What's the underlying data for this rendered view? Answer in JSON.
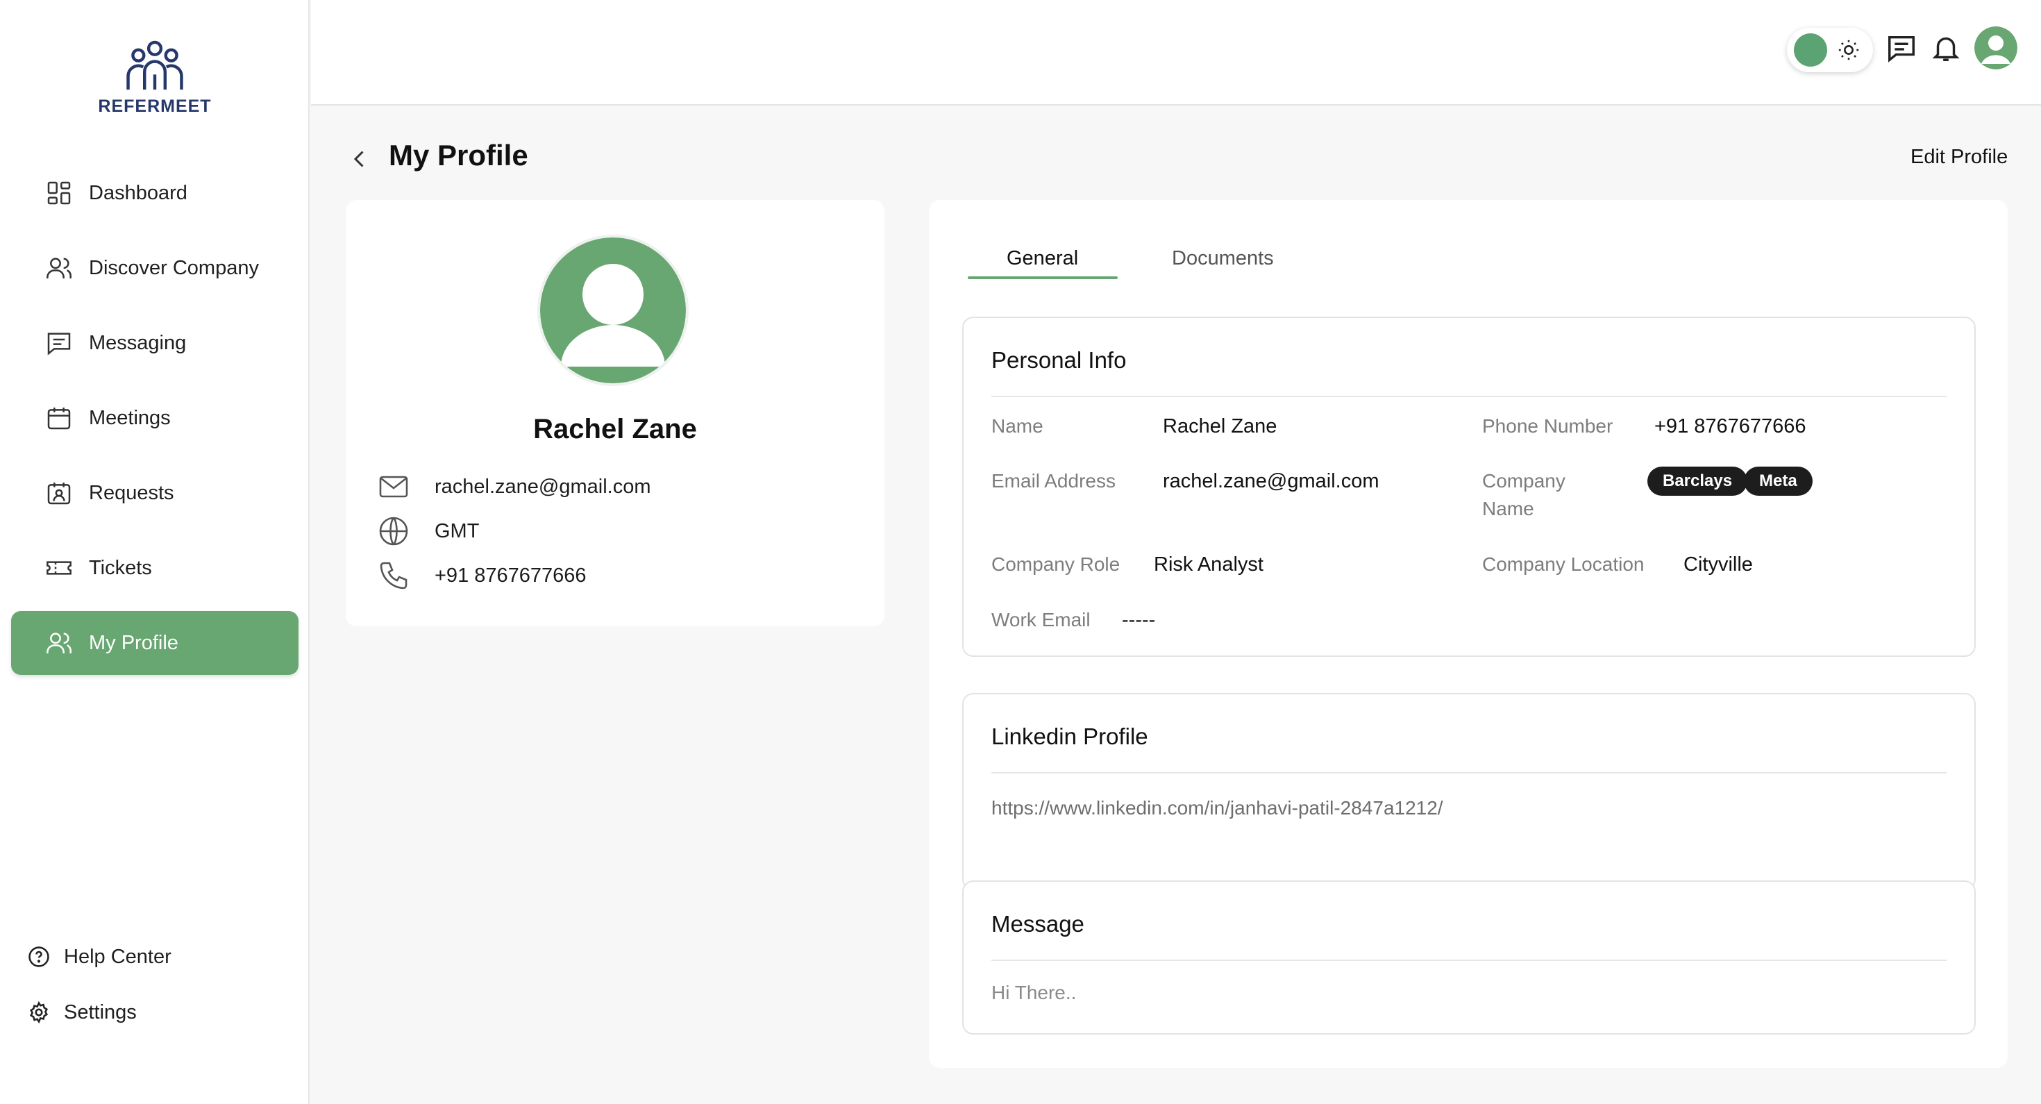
{
  "brand": {
    "name": "REFERMEET"
  },
  "sidebar": {
    "items": [
      {
        "label": "Dashboard",
        "icon": "dashboard-icon"
      },
      {
        "label": "Discover Company",
        "icon": "users-icon"
      },
      {
        "label": "Messaging",
        "icon": "message-icon"
      },
      {
        "label": "Meetings",
        "icon": "calendar-icon"
      },
      {
        "label": "Requests",
        "icon": "request-icon"
      },
      {
        "label": "Tickets",
        "icon": "ticket-icon"
      },
      {
        "label": "My Profile",
        "icon": "profile-icon",
        "active": true
      }
    ],
    "bottom": [
      {
        "label": "Help Center",
        "icon": "help-icon"
      },
      {
        "label": "Settings",
        "icon": "gear-icon"
      }
    ]
  },
  "header": {
    "title": "My Profile",
    "edit_label": "Edit Profile"
  },
  "profile": {
    "name": "Rachel Zane",
    "email": "rachel.zane@gmail.com",
    "timezone": "GMT",
    "phone": "+91 8767677666"
  },
  "tabs": [
    {
      "label": "General",
      "active": true
    },
    {
      "label": "Documents",
      "active": false
    }
  ],
  "personal_info": {
    "title": "Personal Info",
    "name_label": "Name",
    "name_value": "Rachel Zane",
    "phone_label": "Phone Number",
    "phone_value": "+91 8767677666",
    "email_label": "Email Address",
    "email_value": "rachel.zane@gmail.com",
    "company_label_line1": "Company",
    "company_label_line2": "Name",
    "companies": [
      "Barclays",
      "Meta"
    ],
    "role_label": "Company Role",
    "role_value": "Risk Analyst",
    "location_label": "Company Location",
    "location_value": "Cityville",
    "work_email_label": "Work Email",
    "work_email_value": "-----"
  },
  "linkedin": {
    "title": "Linkedin Profile",
    "url": "https://www.linkedin.com/in/janhavi-patil-2847a1212/"
  },
  "message": {
    "title": "Message",
    "text": "Hi There.."
  },
  "colors": {
    "accent": "#68a672",
    "toggle": "#5ba373",
    "brand_text": "#26386b",
    "chip": "#1d1d1d"
  }
}
